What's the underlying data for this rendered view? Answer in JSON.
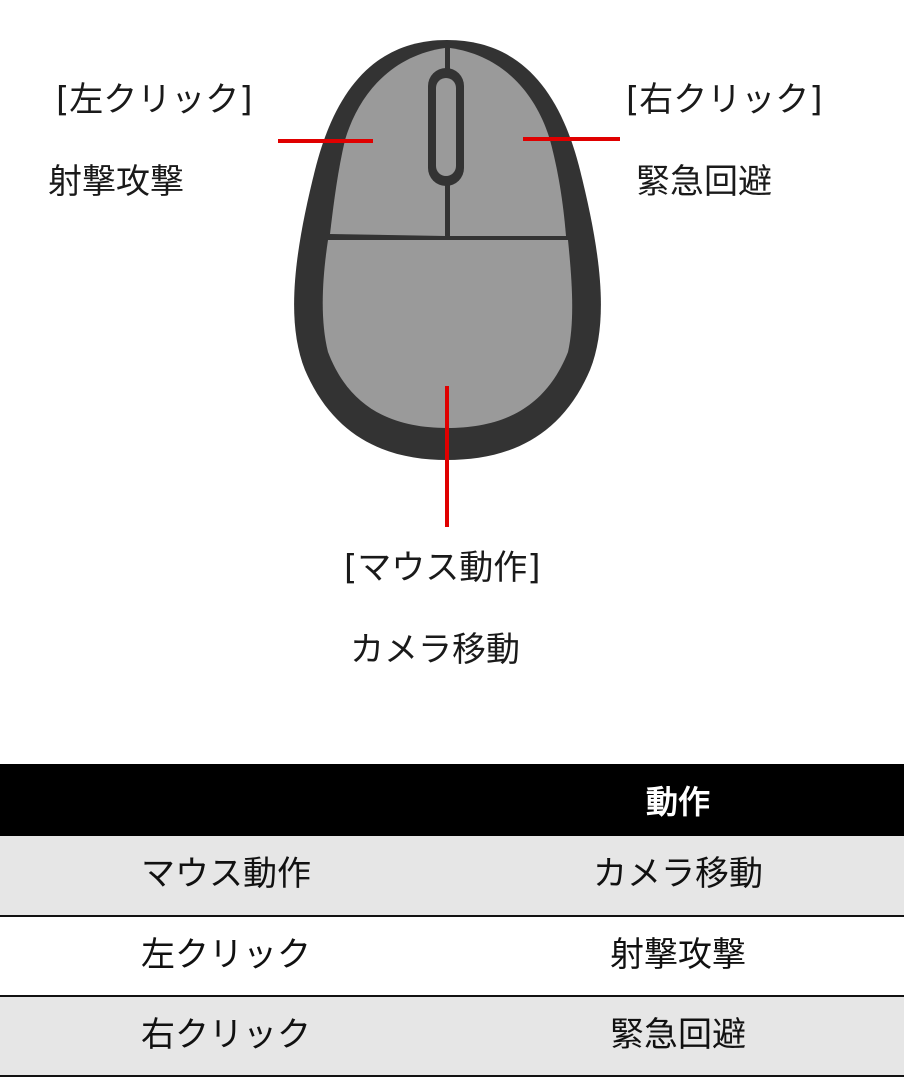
{
  "diagram": {
    "left_click": {
      "title": "[左クリック]",
      "description": "射撃攻撃"
    },
    "right_click": {
      "title": "[右クリック]",
      "description": "緊急回避"
    },
    "mouse_move": {
      "title": "[マウス動作]",
      "description": "カメラ移動"
    },
    "colors": {
      "mouse_body": "#333333",
      "mouse_surface": "#9a9a9a",
      "callout_line": "#e00000"
    }
  },
  "table": {
    "header": {
      "input": "",
      "action": "動作"
    },
    "rows": [
      {
        "input": "マウス動作",
        "action": "カメラ移動"
      },
      {
        "input": "左クリック",
        "action": "射撃攻撃"
      },
      {
        "input": "右クリック",
        "action": "緊急回避"
      }
    ],
    "colors": {
      "header_bg": "#000000",
      "row_alt_bg": "#e6e6e6"
    }
  }
}
